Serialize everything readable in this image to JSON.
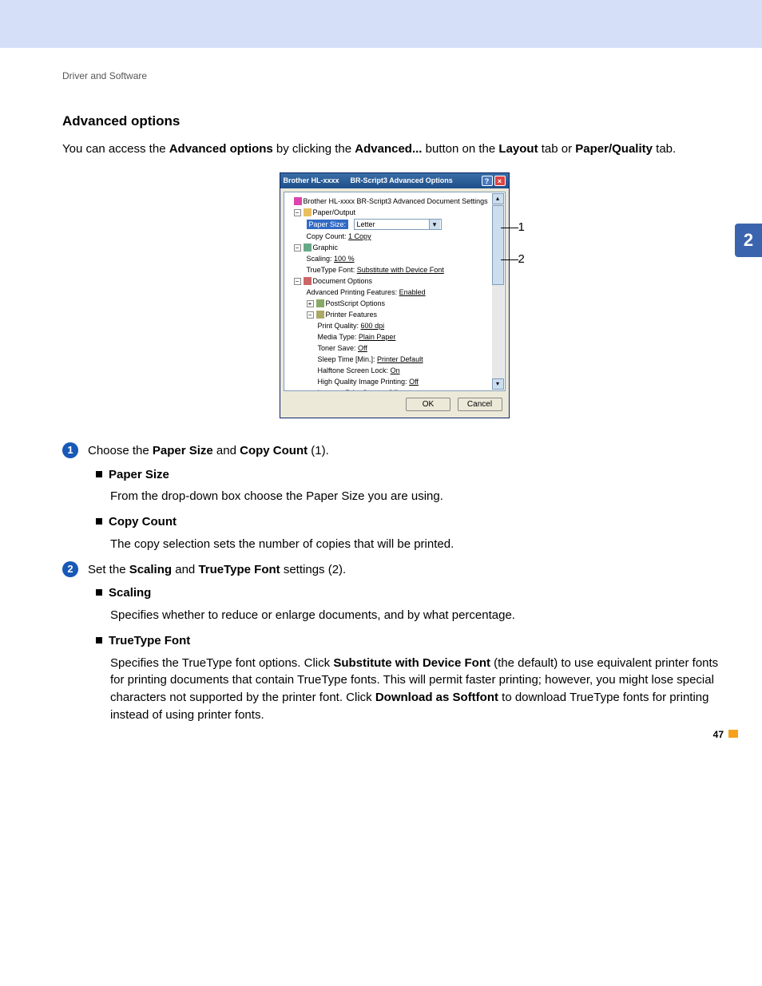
{
  "breadcrumb": "Driver and Software",
  "side_tab": "2",
  "page_number": "47",
  "section_title": "Advanced options",
  "intro": {
    "pre": "You can access the ",
    "b1": "Advanced options",
    "mid1": " by clicking the ",
    "b2": "Advanced...",
    "mid2": " button on the ",
    "b3": "Layout",
    "mid3": " tab or ",
    "b4": "Paper/Quality",
    "post": " tab."
  },
  "dialog": {
    "title_left": "Brother HL-xxxx",
    "title_right": "BR-Script3 Advanced Options",
    "root": "Brother HL-xxxx    BR-Script3 Advanced Document Settings",
    "paper_output": "Paper/Output",
    "paper_size_label": "Paper Size:",
    "paper_size_value": "Letter",
    "copy_count_label": "Copy Count:",
    "copy_count_value": "1 Copy",
    "graphic": "Graphic",
    "scaling_label": "Scaling:",
    "scaling_value": "100 %",
    "truetype_label": "TrueType Font:",
    "truetype_value": "Substitute with Device Font",
    "doc_options": "Document Options",
    "adv_printing_label": "Advanced Printing Features:",
    "adv_printing_value": "Enabled",
    "postscript": "PostScript Options",
    "printer_features": "Printer Features",
    "pf": {
      "pq_l": "Print Quality:",
      "pq_v": "600 dpi",
      "mt_l": "Media Type:",
      "mt_v": "Plain Paper",
      "ts_l": "Toner Save:",
      "ts_v": "Off",
      "st_l": "Sleep Time [Min.]:",
      "st_v": "Printer Default",
      "hs_l": "Halftone Screen Lock:",
      "hs_v": "On",
      "hq_l": "High Quality Image Printing:",
      "hq_v": "Off",
      "ip_l": "Improve Print Output:",
      "ip_v": "Off"
    },
    "ok": "OK",
    "cancel": "Cancel"
  },
  "callout1": "1",
  "callout2": "2",
  "step1": {
    "pre": "Choose the ",
    "b1": "Paper Size",
    "mid": " and ",
    "b2": "Copy Count",
    "post": " (1)."
  },
  "paper_size_h": "Paper Size",
  "paper_size_txt": "From the drop-down box choose the Paper Size you are using.",
  "copy_count_h": "Copy Count",
  "copy_count_txt": "The copy selection sets the number of copies that will be printed.",
  "step2": {
    "pre": "Set the ",
    "b1": "Scaling",
    "mid": " and ",
    "b2": "TrueType Font",
    "post": " settings (2)."
  },
  "scaling_h": "Scaling",
  "scaling_txt": "Specifies whether to reduce or enlarge documents, and by what percentage.",
  "tt_h": "TrueType Font",
  "tt": {
    "p1": "Specifies the TrueType font options. Click ",
    "b1": "Substitute with Device Font",
    "p2": " (the default) to use equivalent printer fonts for printing documents that contain TrueType fonts. This will permit faster printing; however, you might lose special characters not supported by the printer font. Click ",
    "b2": "Download as Softfont",
    "p3": " to download TrueType fonts for printing instead of using printer fonts."
  }
}
